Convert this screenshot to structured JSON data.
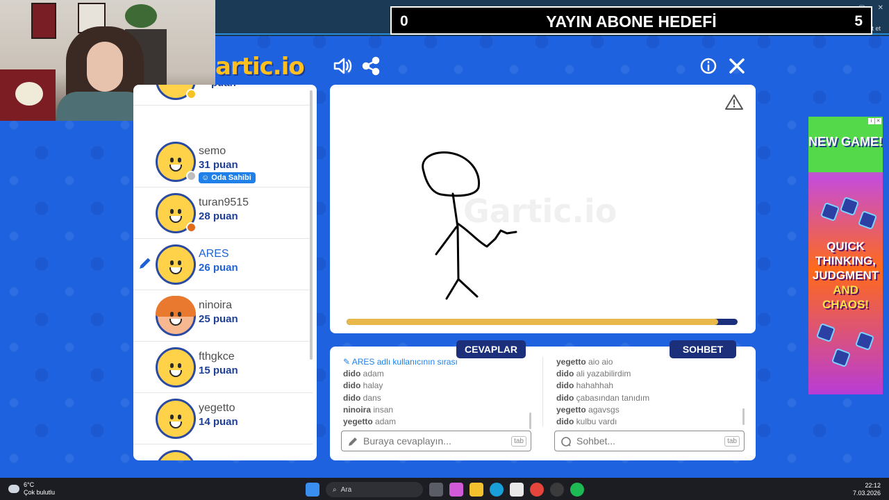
{
  "stream_goal": {
    "current": "0",
    "title": "YAYIN ABONE HEDEFİ",
    "target": "5"
  },
  "browser": {
    "chat_button": "Sohbet et"
  },
  "game": {
    "logo_text": "artic.io",
    "watermark": "Gartic.io",
    "timer_progress": 0.95,
    "colors": {
      "background": "#1f62e0",
      "timer_fill": "#e8b84a",
      "timer_track": "#1b2f7a",
      "accent": "#1e3f97"
    }
  },
  "players": [
    {
      "name": "semo",
      "score": "31 puan",
      "status_color": "#bdbdbd",
      "owner_tag": "Oda Sahibi"
    },
    {
      "name": "turan9515",
      "score": "28 puan",
      "status_color": "#e06b1a"
    },
    {
      "name": "ARES",
      "score": "26 puan",
      "drawing": true
    },
    {
      "name": "ninoira",
      "score": "25 puan",
      "avatar": "girl"
    },
    {
      "name": "fthgkce",
      "score": "15 puan"
    },
    {
      "name": "yegetto",
      "score": "14 puan"
    }
  ],
  "partial_player": {
    "name": "o",
    "score": "puan"
  },
  "answers": {
    "title": "CEVAPLAR",
    "system_msg": "ARES adlı kullanıcının sırası",
    "messages": [
      {
        "user": "dido",
        "text": "adam"
      },
      {
        "user": "dido",
        "text": "halay"
      },
      {
        "user": "dido",
        "text": "dans"
      },
      {
        "user": "ninoira",
        "text": "insan"
      },
      {
        "user": "yegetto",
        "text": "adam"
      }
    ],
    "placeholder": "Buraya cevaplayın...",
    "kbd": "tab"
  },
  "chat": {
    "title": "SOHBET",
    "messages": [
      {
        "user": "yegetto",
        "text": "aio aio"
      },
      {
        "user": "dido",
        "text": "ali yazabilirdim"
      },
      {
        "user": "dido",
        "text": "hahahhah"
      },
      {
        "user": "dido",
        "text": "çabasından tanıdım"
      },
      {
        "user": "yegetto",
        "text": "agavsgs"
      },
      {
        "user": "dido",
        "text": "kulbu vardı"
      }
    ],
    "placeholder": "Sohbet...",
    "kbd": "tab"
  },
  "ad": {
    "headline": "NEW GAME!",
    "line1": "QUICK",
    "line2": "THINKING,",
    "line3": "JUDGMENT",
    "line4": "AND",
    "line5": "CHAOS!"
  },
  "taskbar": {
    "temperature": "6°C",
    "weather": "Çok bulutlu",
    "search": "Ara",
    "time": "22:12",
    "date": "7.03.2026"
  }
}
